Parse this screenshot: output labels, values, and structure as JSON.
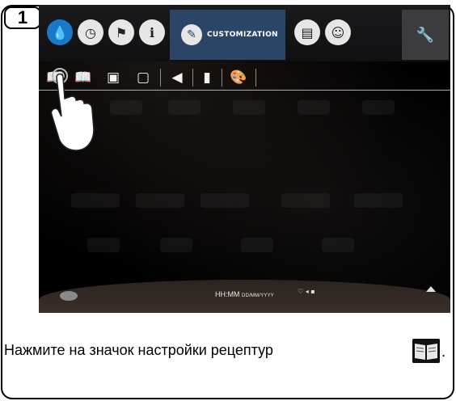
{
  "step": {
    "number": "1"
  },
  "screen": {
    "tabs": [
      {
        "name": "water-drop-icon"
      },
      {
        "name": "clock-icon"
      },
      {
        "name": "flag-icon"
      },
      {
        "name": "info-icon"
      }
    ],
    "active_tab": {
      "label": "CUSTOMIZATION",
      "icon": "pen-icon",
      "color": "#2b4566"
    },
    "right_tabs": [
      {
        "name": "calendar-icon"
      },
      {
        "name": "user-icon"
      }
    ],
    "wrench_icon": "wrench-icon",
    "subtabs": [
      {
        "name": "recipe-book-icon",
        "glyph": "📖"
      },
      {
        "name": "recipe-book-alt-icon",
        "glyph": "📖"
      },
      {
        "name": "picture-icon",
        "glyph": "▣"
      },
      {
        "name": "screen-image-icon",
        "glyph": "▢"
      },
      {
        "name": "speaker-icon",
        "glyph": "◀"
      },
      {
        "name": "battery-icon",
        "glyph": "▮"
      },
      {
        "name": "palette-icon",
        "glyph": "🎨"
      }
    ],
    "datetime": {
      "time": "HH:MM",
      "date": "DD/MM/YYYY"
    },
    "status_icons": "♡ ◂ ▪"
  },
  "caption": {
    "text": "Нажмите на значок настройки рецептур",
    "icon": "recipe-book-icon",
    "punctuation": "."
  }
}
